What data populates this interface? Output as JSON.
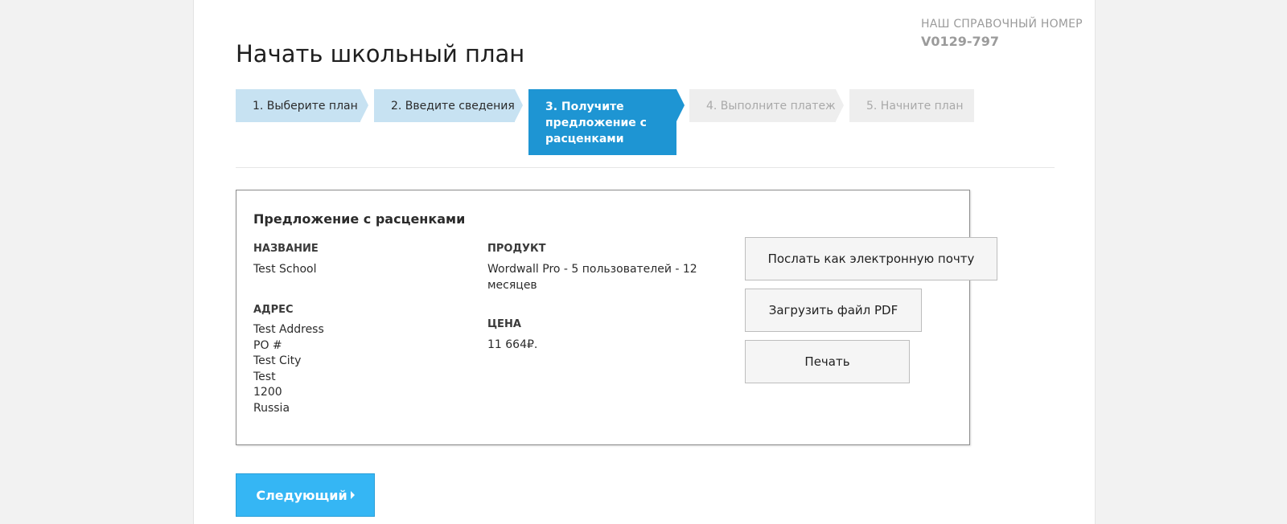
{
  "reference": {
    "label": "НАШ СПРАВОЧНЫЙ НОМЕР",
    "value": "V0129-797"
  },
  "page_title": "Начать школьный план",
  "steps": [
    {
      "label": "1. Выберите план",
      "state": "done"
    },
    {
      "label": "2. Введите сведения",
      "state": "done"
    },
    {
      "label": "3. Получите предложение с расценками",
      "state": "active"
    },
    {
      "label": "4. Выполните платеж",
      "state": "todo"
    },
    {
      "label": "5. Начните план",
      "state": "todo"
    }
  ],
  "quote": {
    "title": "Предложение с расценками",
    "name_label": "НАЗВАНИЕ",
    "name_value": "Test School",
    "address_label": "АДРЕС",
    "address_lines": [
      "Test Address",
      "PO #",
      "Test City",
      "Test",
      "1200",
      "Russia"
    ],
    "product_label": "ПРОДУКТ",
    "product_lines": [
      "Wordwall Pro - 5 пользователей - 12",
      "месяцев"
    ],
    "price_label": "ЦЕНА",
    "price_value": "11 664₽."
  },
  "actions": {
    "email_label": "Послать как электронную почту",
    "pdf_label": "Загрузить файл PDF",
    "print_label": "Печать"
  },
  "next_label": "Следующий",
  "colors": {
    "step_done": "#c7e2f2",
    "step_active": "#1e95d3",
    "step_todo": "#eeeeee",
    "next_button": "#35b6f4"
  }
}
